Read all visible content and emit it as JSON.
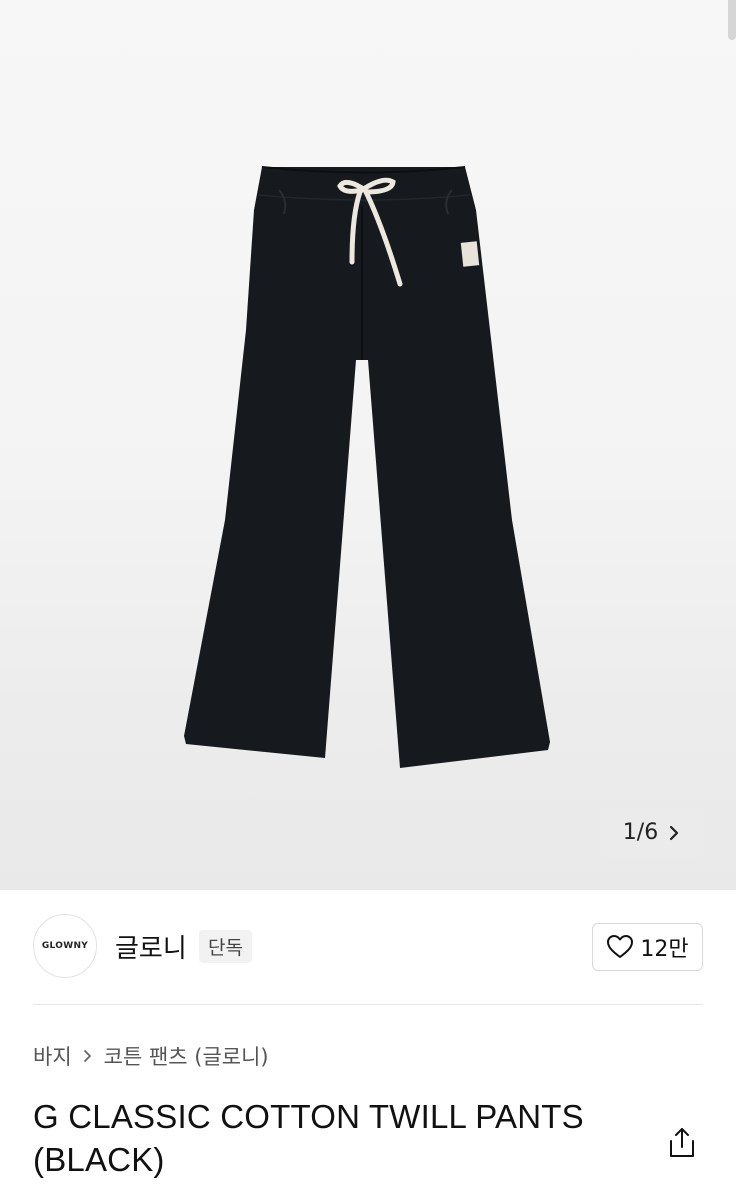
{
  "gallery": {
    "image_alt": "G CLASSIC COTTON TWILL PANTS (BLACK)",
    "counter_current": "1",
    "counter_total": "6",
    "counter_separator": "/",
    "next_icon": "chevron-right-icon"
  },
  "brand": {
    "logo_text": "GLOWNY",
    "name": "글로니",
    "badge": "단독"
  },
  "like": {
    "icon": "heart-icon",
    "count": "12만"
  },
  "breadcrumb": {
    "items": [
      "바지",
      "코튼 팬츠 (글로니)"
    ],
    "separator_icon": "chevron-right-icon"
  },
  "product": {
    "title_line1": "G CLASSIC COTTON TWILL PANTS",
    "title_line2": "(BLACK)"
  },
  "share": {
    "icon": "share-icon"
  },
  "colors": {
    "pants": "#16191d",
    "drawstring": "#ece8dd",
    "background": "#f3f3f3"
  }
}
